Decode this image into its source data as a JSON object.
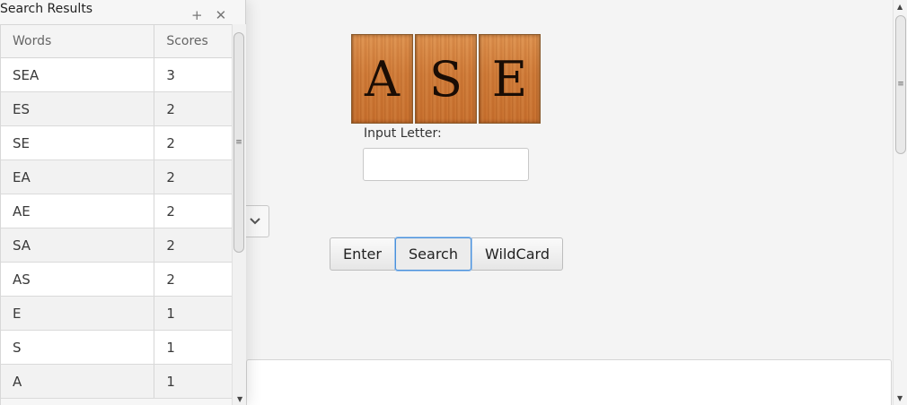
{
  "results_panel": {
    "title": "Search Results",
    "add_icon": "+",
    "close_icon": "✕",
    "columns": [
      "Words",
      "Scores"
    ],
    "rows": [
      {
        "word": "SEA",
        "score": "3"
      },
      {
        "word": "ES",
        "score": "2"
      },
      {
        "word": "SE",
        "score": "2"
      },
      {
        "word": "EA",
        "score": "2"
      },
      {
        "word": "AE",
        "score": "2"
      },
      {
        "word": "SA",
        "score": "2"
      },
      {
        "word": "AS",
        "score": "2"
      },
      {
        "word": "E",
        "score": "1"
      },
      {
        "word": "S",
        "score": "1"
      },
      {
        "word": "A",
        "score": "1"
      }
    ]
  },
  "tiles": [
    "A",
    "S",
    "E"
  ],
  "input": {
    "label": "Input Letter:",
    "value": ""
  },
  "buttons": {
    "enter": "Enter",
    "search": "Search",
    "wildcard": "WildCard"
  },
  "icons": {
    "dropdown": "chevron-down-icon",
    "scroll_grip": "grip-icon",
    "scroll_up": "arrow-up-icon",
    "scroll_down": "arrow-down-icon"
  },
  "colors": {
    "tile_wood": "#d07a36",
    "focus_accent": "#4a90d9"
  }
}
